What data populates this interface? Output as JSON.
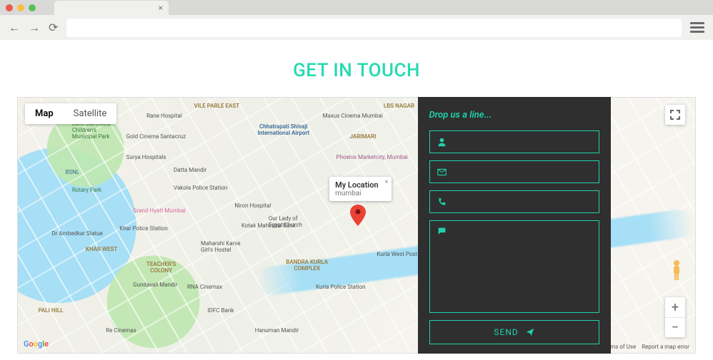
{
  "browser": {
    "tab_close": "×"
  },
  "page": {
    "title": "GET IN TOUCH"
  },
  "map": {
    "type_map": "Map",
    "type_satellite": "Satellite",
    "infowindow": {
      "title": "My Location",
      "subtitle": "mumbai",
      "close": "×"
    },
    "zoom_in": "+",
    "zoom_out": "−",
    "footer": {
      "terms": "Terms of Use",
      "report": "Report a map error"
    },
    "places": {
      "vile_parle": "VILE PARLE EAST",
      "airport": "Chhatrapati Shivaji International Airport",
      "lbs": "LBS NAGAR",
      "jarimari": "JARIMARI",
      "phoenix": "Phoenix Marketcity, Mumbai",
      "bkc": "BANDRA KURLA COMPLEX",
      "khar": "KHAR WEST",
      "teachers": "TEACHER'S COLONY",
      "kurla_po": "Kurla West Post Office",
      "kurla_ps": "Kurla Police Station",
      "pali": "PALI HILL",
      "bsnl": "BSNL",
      "rotary": "Rotary Park",
      "dr_ambedkar": "Dr Ambedkar Statue",
      "hanuman": "Hanuman Mandir",
      "idfc": "IDFC Bank",
      "re_cinemas": "Re Cinemas",
      "kotak": "Kotak Mahindra Bank",
      "grand_hyatt": "Grand Hyatt Mumbai",
      "rna": "RNA Cinemax",
      "maxus": "Maxus Cinema Mumbai",
      "datta": "Datta Mandir",
      "vakola": "Vakola Police Station",
      "niron": "Niron Hospital",
      "egypt": "Our Lady of Egypt Church",
      "gundavali": "Gundavali Mandir",
      "karve": "Maharshi Karve Girl's Hostel",
      "khar_hosp": "Khar Police Station",
      "rane": "Rane Hospital",
      "surya": "Surya Hospitals",
      "gold_santa": "Gold Cinema Santacruz",
      "juhu_child": "Juhu Jamnabai Children's Municipal Park"
    }
  },
  "form": {
    "heading": "Drop us a line...",
    "send": "SEND"
  }
}
